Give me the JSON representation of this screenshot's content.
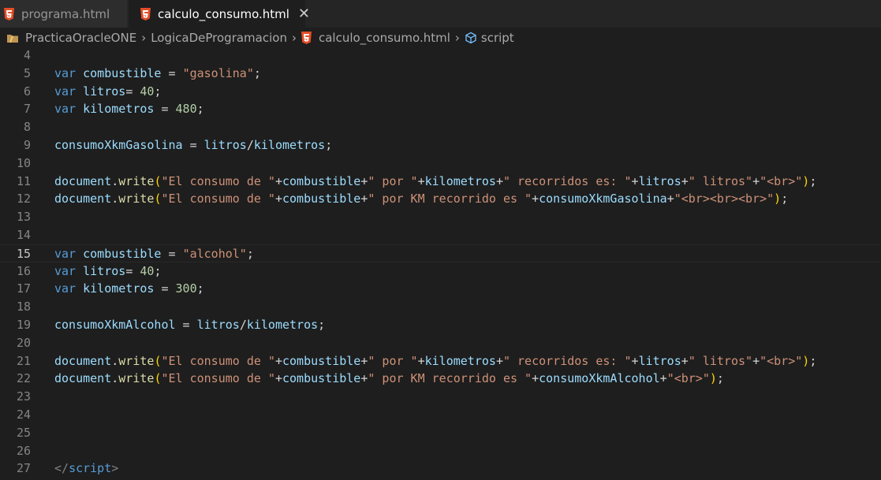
{
  "tabs": [
    {
      "label": "programa.html",
      "active": false,
      "icon": "html5-icon"
    },
    {
      "label": "calculo_consumo.html",
      "active": true,
      "icon": "html5-icon",
      "close_glyph": "✕"
    }
  ],
  "breadcrumbs": [
    {
      "label": "PracticaOracleONE",
      "icon": "folder-icon"
    },
    {
      "label": "LogicaDeProgramacion"
    },
    {
      "label": "calculo_consumo.html",
      "icon": "html5-icon"
    },
    {
      "label": "script",
      "icon": "cube-icon"
    }
  ],
  "colors": {
    "editor_bg": "#1e1e1e",
    "tabbar_bg": "#252526",
    "keyword": "#569cd6",
    "variable": "#9cdcfe",
    "string": "#ce9178",
    "number": "#b5cea8",
    "function": "#dcdcaa",
    "html5_orange": "#e44d26"
  },
  "editor": {
    "active_line": 15,
    "lines": [
      {
        "n": 4,
        "tokens": []
      },
      {
        "n": 5,
        "tokens": [
          [
            "kw",
            "var"
          ],
          [
            "op",
            " "
          ],
          [
            "var",
            "combustible"
          ],
          [
            "op",
            " = "
          ],
          [
            "str",
            "\"gasolina\""
          ],
          [
            "op",
            ";"
          ]
        ]
      },
      {
        "n": 6,
        "tokens": [
          [
            "kw",
            "var"
          ],
          [
            "op",
            " "
          ],
          [
            "var",
            "litros"
          ],
          [
            "op",
            "= "
          ],
          [
            "num",
            "40"
          ],
          [
            "op",
            ";"
          ]
        ]
      },
      {
        "n": 7,
        "tokens": [
          [
            "kw",
            "var"
          ],
          [
            "op",
            " "
          ],
          [
            "var",
            "kilometros"
          ],
          [
            "op",
            " = "
          ],
          [
            "num",
            "480"
          ],
          [
            "op",
            ";"
          ]
        ]
      },
      {
        "n": 8,
        "tokens": []
      },
      {
        "n": 9,
        "tokens": [
          [
            "var",
            "consumoXkmGasolina"
          ],
          [
            "op",
            " = "
          ],
          [
            "var",
            "litros"
          ],
          [
            "op",
            "/"
          ],
          [
            "var",
            "kilometros"
          ],
          [
            "op",
            ";"
          ]
        ]
      },
      {
        "n": 10,
        "tokens": []
      },
      {
        "n": 11,
        "tokens": [
          [
            "var",
            "document"
          ],
          [
            "op",
            "."
          ],
          [
            "fn",
            "write"
          ],
          [
            "br1",
            "("
          ],
          [
            "str",
            "\"El consumo de \""
          ],
          [
            "op",
            "+"
          ],
          [
            "var",
            "combustible"
          ],
          [
            "op",
            "+"
          ],
          [
            "str",
            "\" por \""
          ],
          [
            "op",
            "+"
          ],
          [
            "var",
            "kilometros"
          ],
          [
            "op",
            "+"
          ],
          [
            "str",
            "\" recorridos es: \""
          ],
          [
            "op",
            "+"
          ],
          [
            "var",
            "litros"
          ],
          [
            "op",
            "+"
          ],
          [
            "str",
            "\" litros\""
          ],
          [
            "op",
            "+"
          ],
          [
            "str",
            "\"<br>\""
          ],
          [
            "br1",
            ")"
          ],
          [
            "op",
            ";"
          ]
        ]
      },
      {
        "n": 12,
        "tokens": [
          [
            "var",
            "document"
          ],
          [
            "op",
            "."
          ],
          [
            "fn",
            "write"
          ],
          [
            "br1",
            "("
          ],
          [
            "str",
            "\"El consumo de \""
          ],
          [
            "op",
            "+"
          ],
          [
            "var",
            "combustible"
          ],
          [
            "op",
            "+"
          ],
          [
            "str",
            "\" por KM recorrido es \""
          ],
          [
            "op",
            "+"
          ],
          [
            "var",
            "consumoXkmGasolina"
          ],
          [
            "op",
            "+"
          ],
          [
            "str",
            "\"<br><br><br>\""
          ],
          [
            "br1",
            ")"
          ],
          [
            "op",
            ";"
          ]
        ]
      },
      {
        "n": 13,
        "tokens": []
      },
      {
        "n": 14,
        "tokens": []
      },
      {
        "n": 15,
        "tokens": [
          [
            "kw",
            "var"
          ],
          [
            "op",
            " "
          ],
          [
            "var",
            "combustible"
          ],
          [
            "op",
            " = "
          ],
          [
            "str",
            "\"alcohol\""
          ],
          [
            "op",
            ";"
          ]
        ]
      },
      {
        "n": 16,
        "tokens": [
          [
            "kw",
            "var"
          ],
          [
            "op",
            " "
          ],
          [
            "var",
            "litros"
          ],
          [
            "op",
            "= "
          ],
          [
            "num",
            "40"
          ],
          [
            "op",
            ";"
          ]
        ]
      },
      {
        "n": 17,
        "tokens": [
          [
            "kw",
            "var"
          ],
          [
            "op",
            " "
          ],
          [
            "var",
            "kilometros"
          ],
          [
            "op",
            " = "
          ],
          [
            "num",
            "300"
          ],
          [
            "op",
            ";"
          ]
        ]
      },
      {
        "n": 18,
        "tokens": []
      },
      {
        "n": 19,
        "tokens": [
          [
            "var",
            "consumoXkmAlcohol"
          ],
          [
            "op",
            " = "
          ],
          [
            "var",
            "litros"
          ],
          [
            "op",
            "/"
          ],
          [
            "var",
            "kilometros"
          ],
          [
            "op",
            ";"
          ]
        ]
      },
      {
        "n": 20,
        "tokens": []
      },
      {
        "n": 21,
        "tokens": [
          [
            "var",
            "document"
          ],
          [
            "op",
            "."
          ],
          [
            "fn",
            "write"
          ],
          [
            "br1",
            "("
          ],
          [
            "str",
            "\"El consumo de \""
          ],
          [
            "op",
            "+"
          ],
          [
            "var",
            "combustible"
          ],
          [
            "op",
            "+"
          ],
          [
            "str",
            "\" por \""
          ],
          [
            "op",
            "+"
          ],
          [
            "var",
            "kilometros"
          ],
          [
            "op",
            "+"
          ],
          [
            "str",
            "\" recorridos es: \""
          ],
          [
            "op",
            "+"
          ],
          [
            "var",
            "litros"
          ],
          [
            "op",
            "+"
          ],
          [
            "str",
            "\" litros\""
          ],
          [
            "op",
            "+"
          ],
          [
            "str",
            "\"<br>\""
          ],
          [
            "br1",
            ")"
          ],
          [
            "op",
            ";"
          ]
        ]
      },
      {
        "n": 22,
        "tokens": [
          [
            "var",
            "document"
          ],
          [
            "op",
            "."
          ],
          [
            "fn",
            "write"
          ],
          [
            "br1",
            "("
          ],
          [
            "str",
            "\"El consumo de \""
          ],
          [
            "op",
            "+"
          ],
          [
            "var",
            "combustible"
          ],
          [
            "op",
            "+"
          ],
          [
            "str",
            "\" por KM recorrido es \""
          ],
          [
            "op",
            "+"
          ],
          [
            "var",
            "consumoXkmAlcohol"
          ],
          [
            "op",
            "+"
          ],
          [
            "str",
            "\"<br>\""
          ],
          [
            "br1",
            ")"
          ],
          [
            "op",
            ";"
          ]
        ]
      },
      {
        "n": 23,
        "tokens": []
      },
      {
        "n": 24,
        "tokens": []
      },
      {
        "n": 25,
        "tokens": []
      },
      {
        "n": 26,
        "tokens": []
      },
      {
        "n": 27,
        "tokens": [
          [
            "tag",
            "</"
          ],
          [
            "tagname",
            "script"
          ],
          [
            "tag",
            ">"
          ]
        ]
      }
    ]
  }
}
